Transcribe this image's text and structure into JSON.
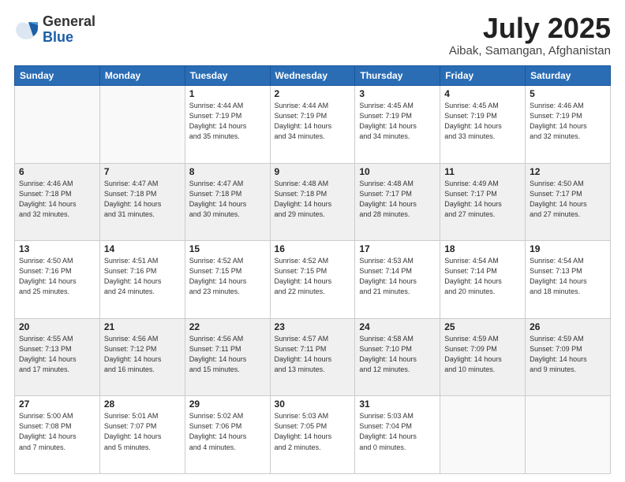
{
  "logo": {
    "general": "General",
    "blue": "Blue"
  },
  "title": "July 2025",
  "subtitle": "Aibak, Samangan, Afghanistan",
  "days_of_week": [
    "Sunday",
    "Monday",
    "Tuesday",
    "Wednesday",
    "Thursday",
    "Friday",
    "Saturday"
  ],
  "weeks": [
    [
      {
        "day": "",
        "info": ""
      },
      {
        "day": "",
        "info": ""
      },
      {
        "day": "1",
        "info": "Sunrise: 4:44 AM\nSunset: 7:19 PM\nDaylight: 14 hours\nand 35 minutes."
      },
      {
        "day": "2",
        "info": "Sunrise: 4:44 AM\nSunset: 7:19 PM\nDaylight: 14 hours\nand 34 minutes."
      },
      {
        "day": "3",
        "info": "Sunrise: 4:45 AM\nSunset: 7:19 PM\nDaylight: 14 hours\nand 34 minutes."
      },
      {
        "day": "4",
        "info": "Sunrise: 4:45 AM\nSunset: 7:19 PM\nDaylight: 14 hours\nand 33 minutes."
      },
      {
        "day": "5",
        "info": "Sunrise: 4:46 AM\nSunset: 7:19 PM\nDaylight: 14 hours\nand 32 minutes."
      }
    ],
    [
      {
        "day": "6",
        "info": "Sunrise: 4:46 AM\nSunset: 7:18 PM\nDaylight: 14 hours\nand 32 minutes."
      },
      {
        "day": "7",
        "info": "Sunrise: 4:47 AM\nSunset: 7:18 PM\nDaylight: 14 hours\nand 31 minutes."
      },
      {
        "day": "8",
        "info": "Sunrise: 4:47 AM\nSunset: 7:18 PM\nDaylight: 14 hours\nand 30 minutes."
      },
      {
        "day": "9",
        "info": "Sunrise: 4:48 AM\nSunset: 7:18 PM\nDaylight: 14 hours\nand 29 minutes."
      },
      {
        "day": "10",
        "info": "Sunrise: 4:48 AM\nSunset: 7:17 PM\nDaylight: 14 hours\nand 28 minutes."
      },
      {
        "day": "11",
        "info": "Sunrise: 4:49 AM\nSunset: 7:17 PM\nDaylight: 14 hours\nand 27 minutes."
      },
      {
        "day": "12",
        "info": "Sunrise: 4:50 AM\nSunset: 7:17 PM\nDaylight: 14 hours\nand 27 minutes."
      }
    ],
    [
      {
        "day": "13",
        "info": "Sunrise: 4:50 AM\nSunset: 7:16 PM\nDaylight: 14 hours\nand 25 minutes."
      },
      {
        "day": "14",
        "info": "Sunrise: 4:51 AM\nSunset: 7:16 PM\nDaylight: 14 hours\nand 24 minutes."
      },
      {
        "day": "15",
        "info": "Sunrise: 4:52 AM\nSunset: 7:15 PM\nDaylight: 14 hours\nand 23 minutes."
      },
      {
        "day": "16",
        "info": "Sunrise: 4:52 AM\nSunset: 7:15 PM\nDaylight: 14 hours\nand 22 minutes."
      },
      {
        "day": "17",
        "info": "Sunrise: 4:53 AM\nSunset: 7:14 PM\nDaylight: 14 hours\nand 21 minutes."
      },
      {
        "day": "18",
        "info": "Sunrise: 4:54 AM\nSunset: 7:14 PM\nDaylight: 14 hours\nand 20 minutes."
      },
      {
        "day": "19",
        "info": "Sunrise: 4:54 AM\nSunset: 7:13 PM\nDaylight: 14 hours\nand 18 minutes."
      }
    ],
    [
      {
        "day": "20",
        "info": "Sunrise: 4:55 AM\nSunset: 7:13 PM\nDaylight: 14 hours\nand 17 minutes."
      },
      {
        "day": "21",
        "info": "Sunrise: 4:56 AM\nSunset: 7:12 PM\nDaylight: 14 hours\nand 16 minutes."
      },
      {
        "day": "22",
        "info": "Sunrise: 4:56 AM\nSunset: 7:11 PM\nDaylight: 14 hours\nand 15 minutes."
      },
      {
        "day": "23",
        "info": "Sunrise: 4:57 AM\nSunset: 7:11 PM\nDaylight: 14 hours\nand 13 minutes."
      },
      {
        "day": "24",
        "info": "Sunrise: 4:58 AM\nSunset: 7:10 PM\nDaylight: 14 hours\nand 12 minutes."
      },
      {
        "day": "25",
        "info": "Sunrise: 4:59 AM\nSunset: 7:09 PM\nDaylight: 14 hours\nand 10 minutes."
      },
      {
        "day": "26",
        "info": "Sunrise: 4:59 AM\nSunset: 7:09 PM\nDaylight: 14 hours\nand 9 minutes."
      }
    ],
    [
      {
        "day": "27",
        "info": "Sunrise: 5:00 AM\nSunset: 7:08 PM\nDaylight: 14 hours\nand 7 minutes."
      },
      {
        "day": "28",
        "info": "Sunrise: 5:01 AM\nSunset: 7:07 PM\nDaylight: 14 hours\nand 5 minutes."
      },
      {
        "day": "29",
        "info": "Sunrise: 5:02 AM\nSunset: 7:06 PM\nDaylight: 14 hours\nand 4 minutes."
      },
      {
        "day": "30",
        "info": "Sunrise: 5:03 AM\nSunset: 7:05 PM\nDaylight: 14 hours\nand 2 minutes."
      },
      {
        "day": "31",
        "info": "Sunrise: 5:03 AM\nSunset: 7:04 PM\nDaylight: 14 hours\nand 0 minutes."
      },
      {
        "day": "",
        "info": ""
      },
      {
        "day": "",
        "info": ""
      }
    ]
  ]
}
